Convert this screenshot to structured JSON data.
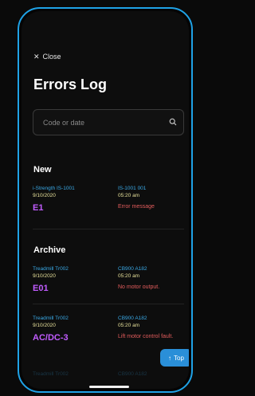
{
  "header": {
    "close_label": "Close",
    "title": "Errors Log"
  },
  "search": {
    "placeholder": "Code or date"
  },
  "sections": {
    "new": "New",
    "archive": "Archive"
  },
  "new_entries": [
    {
      "device": "i-Strength IS-1001",
      "date": "9/10/2020",
      "code": "E1",
      "serial": "IS-1001 001",
      "time": "05:20 am",
      "message": "Error message"
    }
  ],
  "archive_entries": [
    {
      "device": "Treadmill Tr002",
      "date": "9/10/2020",
      "code": "E01",
      "serial": "CB900 A182",
      "time": "05:20 am",
      "message": "No motor output."
    },
    {
      "device": "Treadmill Tr002",
      "date": "9/10/2020",
      "code": "AC/DC-3",
      "serial": "CB900 A182",
      "time": "05:20 am",
      "message": "Lift motor control fault."
    },
    {
      "device": "Treadmill Tr002",
      "serial": "CB900 A182"
    }
  ],
  "top_button": {
    "label": "Top"
  },
  "colors": {
    "accent": "#1fa2e6",
    "code": "#c15cff",
    "message": "#e25c5c",
    "date": "#e6e09a",
    "device": "#3aa9e6"
  }
}
